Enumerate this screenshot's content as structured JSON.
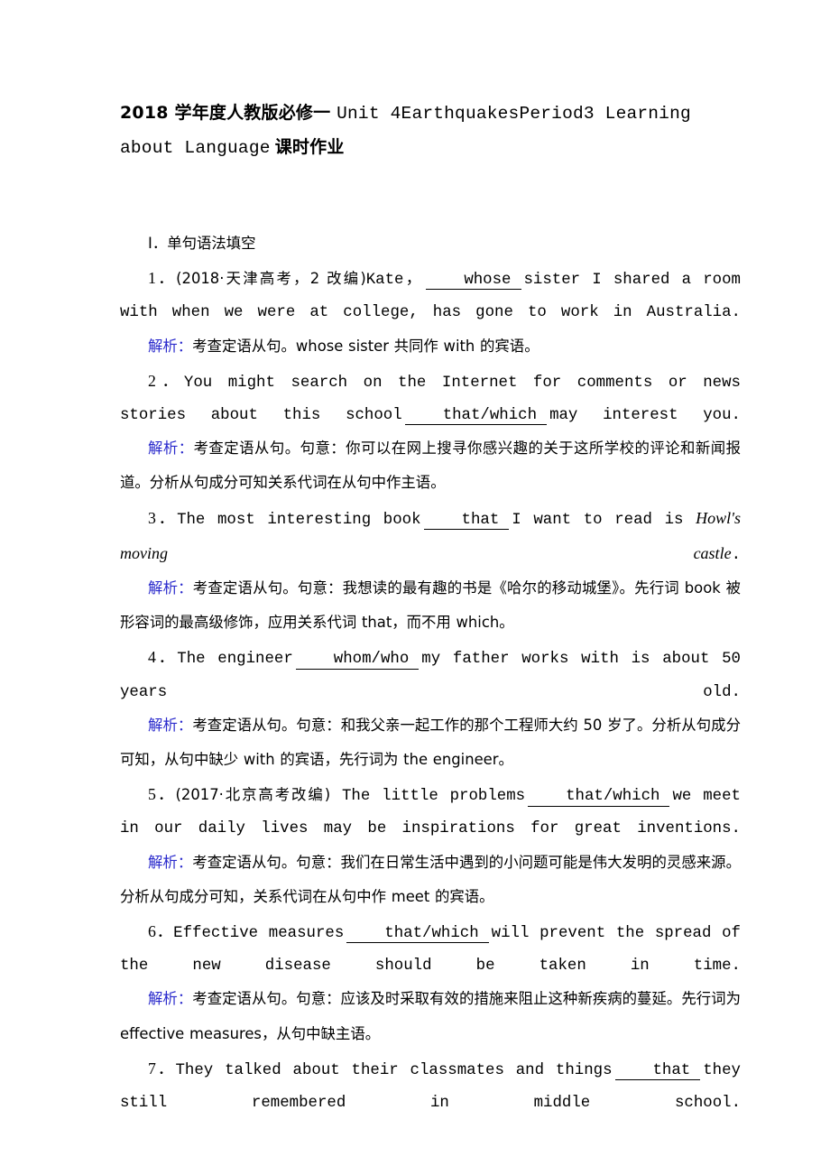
{
  "document": {
    "title_cn_1": "2018 学年度人教版必修一 ",
    "title_en": "Unit 4EarthquakesPeriod3 Learning about Language",
    "title_cn_2": "课时作业",
    "accent_blue": "#2a2acc",
    "page_background": "#ffffff",
    "text_color": "#000000"
  },
  "section": {
    "heading": "Ⅰ．单句语法填空"
  },
  "questions": [
    {
      "number": "1．",
      "source": "(2018·天津高考，2 改编)",
      "stem_before": "Kate，",
      "answer": "whose",
      "stem_after": "sister I shared a room with when we were at college, has gone to work in Australia.",
      "analysis_label": "解析：",
      "analysis_text": "考查定语从句。whose sister 共同作 with 的宾语。"
    },
    {
      "number": "2．",
      "source": "",
      "stem_before": "You might search on the Internet for comments or news stories about this school",
      "answer": "that/which",
      "stem_after": "may interest you.",
      "analysis_label": "解析：",
      "analysis_text": "考查定语从句。句意：你可以在网上搜寻你感兴趣的关于这所学校的评论和新闻报道。分析从句成分可知关系代词在从句中作主语。"
    },
    {
      "number": "3．",
      "source": "",
      "stem_before": "The most interesting book",
      "answer": "that",
      "stem_after": "I want to read is ",
      "stem_italic": "Howl's moving castle",
      "stem_tail": ".",
      "analysis_label": "解析：",
      "analysis_text": "考查定语从句。句意：我想读的最有趣的书是《哈尔的移动城堡》。先行词 book 被形容词的最高级修饰，应用关系代词 that，而不用 which。"
    },
    {
      "number": "4．",
      "source": "",
      "stem_before": "The engineer",
      "answer": "whom/who",
      "stem_after": "my father works with is about 50 years old.",
      "analysis_label": "解析：",
      "analysis_text": "考查定语从句。句意：和我父亲一起工作的那个工程师大约 50 岁了。分析从句成分可知，从句中缺少 with 的宾语，先行词为 the engineer。"
    },
    {
      "number": "5．",
      "source": "(2017·北京高考改编)",
      "stem_before": " The little problems",
      "answer": "that/which",
      "stem_after": "we meet in our daily lives may be inspirations for great inventions.",
      "analysis_label": "解析：",
      "analysis_text": "考查定语从句。句意：我们在日常生活中遇到的小问题可能是伟大发明的灵感来源。分析从句成分可知，关系代词在从句中作 meet 的宾语。"
    },
    {
      "number": "6．",
      "source": "",
      "stem_before": "Effective measures",
      "answer": "that/which",
      "stem_after": "will prevent the spread of the new disease should be taken in time.",
      "analysis_label": "解析：",
      "analysis_text": "考查定语从句。句意：应该及时采取有效的措施来阻止这种新疾病的蔓延。先行词为 effective measures，从句中缺主语。"
    },
    {
      "number": "7．",
      "source": "",
      "stem_before": "They talked about their classmates and things",
      "answer": "that",
      "stem_after": "they still remembered in middle school.",
      "analysis_label": "",
      "analysis_text": ""
    }
  ]
}
